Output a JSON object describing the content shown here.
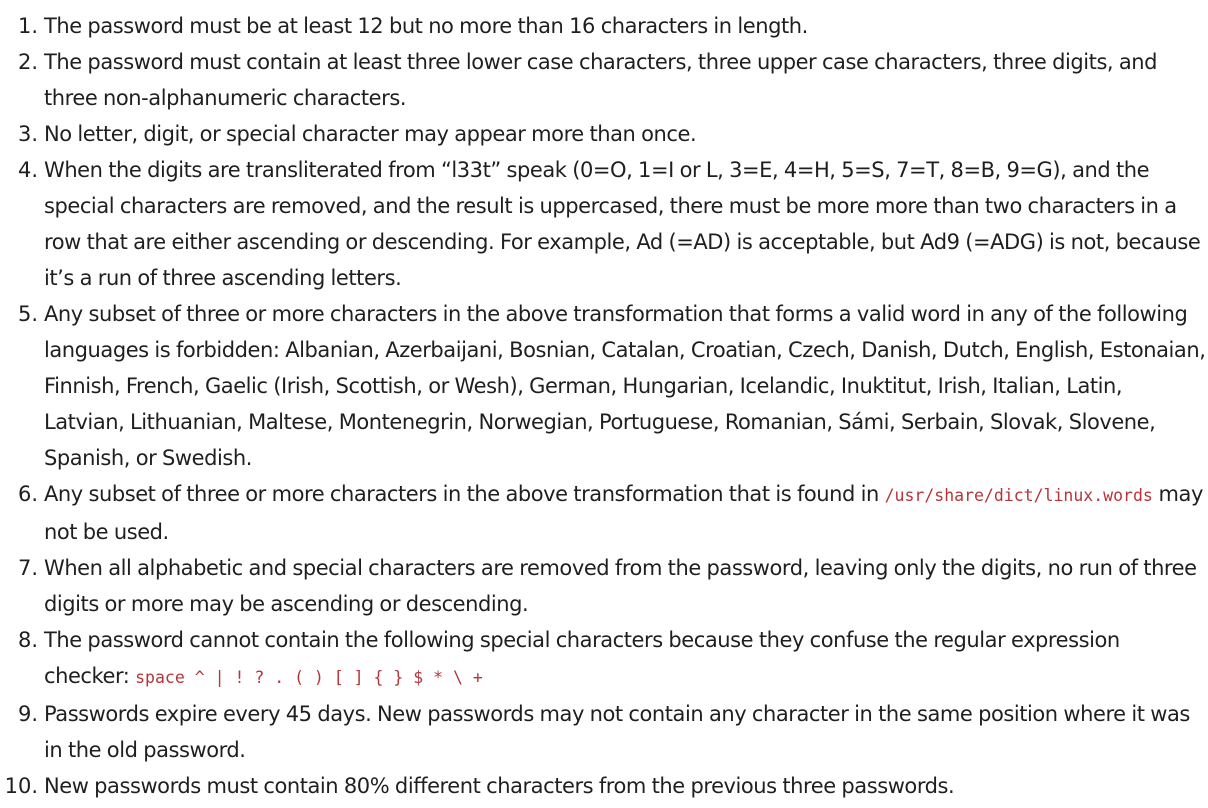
{
  "rules": [
    {
      "number": "1.",
      "segments": [
        {
          "type": "text",
          "text": "The password must be at least 12 but no more than 16 characters in length."
        }
      ]
    },
    {
      "number": "2.",
      "segments": [
        {
          "type": "text",
          "text": "The password must contain at least three lower case characters, three upper case characters, three digits, and three non-alphanumeric characters."
        }
      ]
    },
    {
      "number": "3.",
      "segments": [
        {
          "type": "text",
          "text": "No letter, digit, or special character may appear more than once."
        }
      ]
    },
    {
      "number": "4.",
      "segments": [
        {
          "type": "text",
          "text": "When the digits are transliterated from “l33t” speak (0=O, 1=I or L, 3=E, 4=H, 5=S, 7=T, 8=B, 9=G), and the special characters are removed, and the result is uppercased, there must be more more than two characters in a row that are either ascending or descending. For example, Ad (=AD) is acceptable, but Ad9 (=ADG) is not, because it’s a run of three ascending letters."
        }
      ]
    },
    {
      "number": "5.",
      "segments": [
        {
          "type": "text",
          "text": "Any subset of three or more characters in the above transformation that forms a valid word in any of the following languages is forbidden: Albanian, Azerbaijani, Bosnian, Catalan, Croatian, Czech, Danish, Dutch, English, Estonaian, Finnish, French, Gaelic (Irish, Scottish, or Wesh), German, Hungarian, Icelandic, Inuktitut, Irish, Italian, Latin, Latvian, Lithuanian, Maltese, Montenegrin, Norwegian, Portuguese, Romanian, Sámi, Serbain, Slovak, Slovene, Spanish, or Swedish."
        }
      ]
    },
    {
      "number": "6.",
      "segments": [
        {
          "type": "text",
          "text": "Any subset of three or more characters in the above transformation that is found in "
        },
        {
          "type": "code",
          "text": "/usr/share/dict/linux.words"
        },
        {
          "type": "text",
          "text": " may not be used."
        }
      ]
    },
    {
      "number": "7.",
      "segments": [
        {
          "type": "text",
          "text": "When all alphabetic and special characters are removed from the password, leaving only the digits, no run of three digits or more may be ascending or descending."
        }
      ]
    },
    {
      "number": "8.",
      "segments": [
        {
          "type": "text",
          "text": "The password cannot contain the following special characters because they confuse the regular expression checker: "
        },
        {
          "type": "code",
          "text": "space ^ | ! ? . ( ) [ ] { } $ * \\ +"
        }
      ]
    },
    {
      "number": "9.",
      "segments": [
        {
          "type": "text",
          "text": "Passwords expire every 45 days. New passwords may not contain any character in the same position where it was in the old password."
        }
      ]
    },
    {
      "number": "10.",
      "segments": [
        {
          "type": "text",
          "text": "New passwords must contain 80% different characters from the previous three passwords."
        }
      ]
    }
  ]
}
